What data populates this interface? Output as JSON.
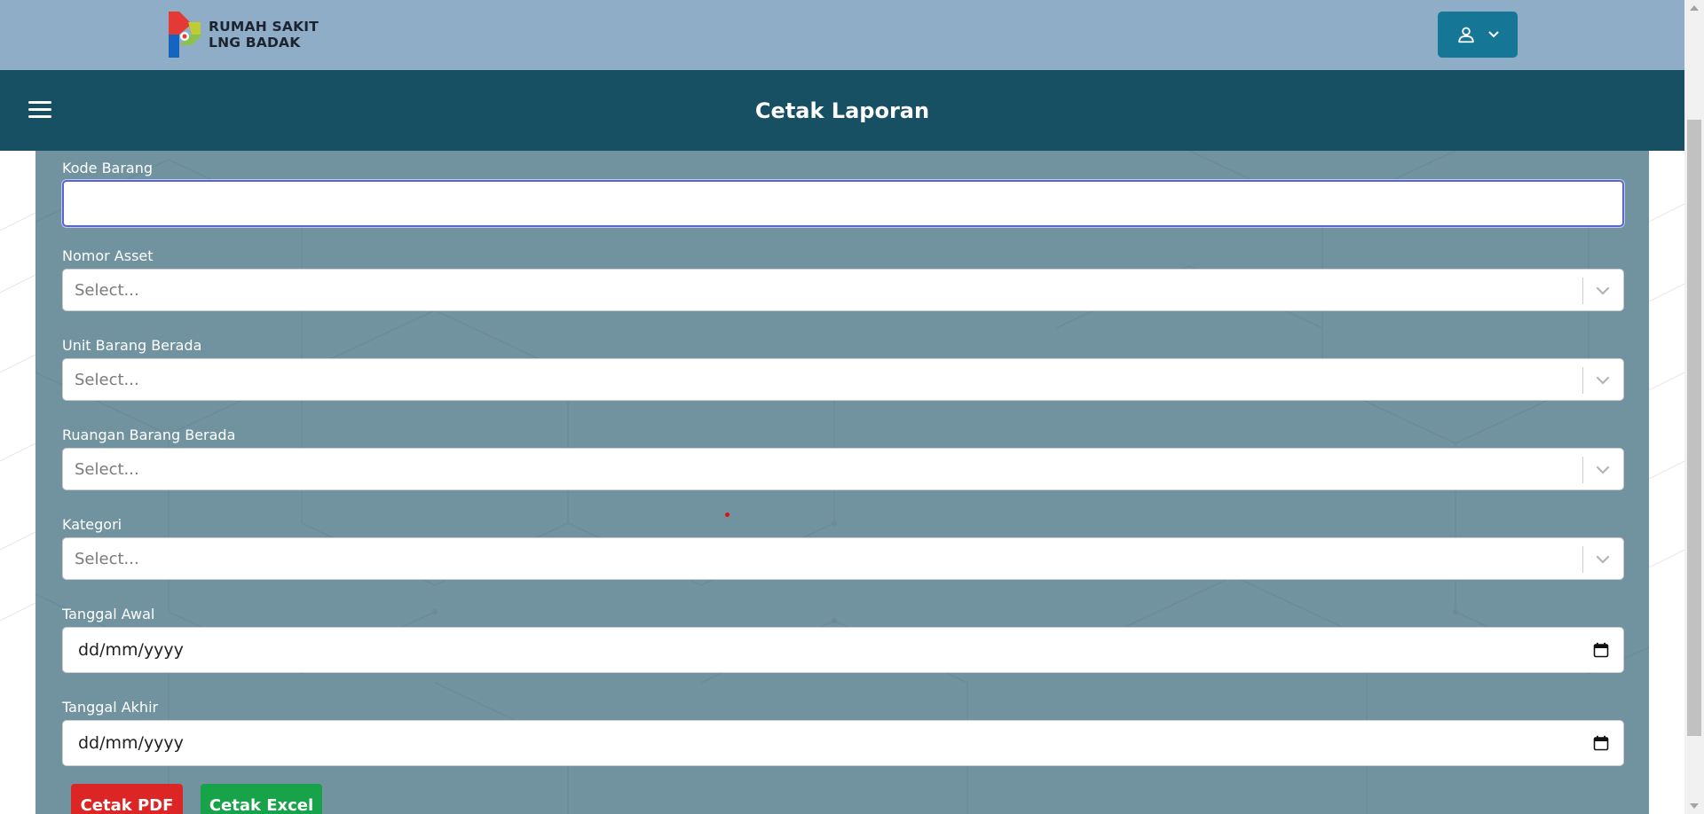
{
  "brand": {
    "line1": "RUMAH SAKIT",
    "line2": "LNG BADAK",
    "colors": {
      "red": "#e53935",
      "green": "#8bc34a",
      "blue": "#1565c0"
    }
  },
  "user_menu": {
    "icon": "user-icon",
    "caret": "chevron-down-icon"
  },
  "header": {
    "title": "Cetak Laporan",
    "menu_icon": "hamburger-icon"
  },
  "form": {
    "kode_barang": {
      "label": "Kode Barang",
      "value": ""
    },
    "nomor_asset": {
      "label": "Nomor Asset",
      "placeholder": "Select..."
    },
    "unit_barang": {
      "label": "Unit Barang Berada",
      "placeholder": "Select..."
    },
    "ruangan_barang": {
      "label": "Ruangan Barang Berada",
      "placeholder": "Select..."
    },
    "kategori": {
      "label": "Kategori",
      "placeholder": "Select..."
    },
    "tanggal_awal": {
      "label": "Tanggal Awal",
      "placeholder": "dd/mm/yyyy"
    },
    "tanggal_akhir": {
      "label": "Tanggal Akhir",
      "placeholder": "dd/mm/yyyy"
    }
  },
  "actions": {
    "pdf": "Cetak PDF",
    "excel": "Cetak Excel"
  },
  "theme": {
    "topbar": "#8fadc6",
    "header": "#174f63",
    "card": "#71939f",
    "user_button": "#157795",
    "pdf_button": "#dc2626",
    "excel_button": "#17a34a"
  }
}
